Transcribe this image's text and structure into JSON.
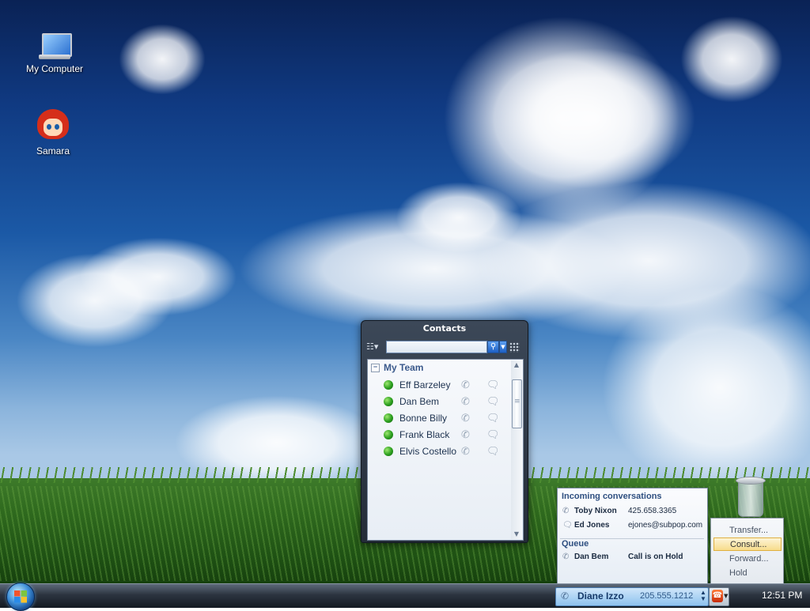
{
  "desktop": {
    "icons": [
      {
        "label": "My Computer",
        "icon": "computer-icon"
      },
      {
        "label": "Samara",
        "icon": "avatar-icon"
      }
    ],
    "recycle_bin_icon": "recycle-bin-icon"
  },
  "contacts_window": {
    "title": "Contacts",
    "search": {
      "placeholder": "",
      "value": ""
    },
    "group": {
      "label": "My Team",
      "expanded": true
    },
    "contacts": [
      {
        "name": "Eff Barzeley",
        "status": "online"
      },
      {
        "name": "Dan Bem",
        "status": "online"
      },
      {
        "name": "Bonne Billy",
        "status": "online"
      },
      {
        "name": "Frank Black",
        "status": "online"
      },
      {
        "name": "Elvis Costello",
        "status": "online"
      }
    ]
  },
  "conversations": {
    "incoming_header": "Incoming conversations",
    "incoming": [
      {
        "name": "Toby Nixon",
        "value": "425.658.3365",
        "icon": "phone-icon"
      },
      {
        "name": "Ed Jones",
        "value": "ejones@subpop.com",
        "icon": "chat-icon"
      }
    ],
    "queue_header": "Queue",
    "queue": [
      {
        "name": "Dan Bem",
        "value": "Call is on Hold",
        "icon": "phone-icon"
      }
    ]
  },
  "call_menu": {
    "items": [
      {
        "label": "Transfer...",
        "highlighted": false
      },
      {
        "label": "Consult...",
        "highlighted": true
      },
      {
        "label": "Forward...",
        "highlighted": false
      },
      {
        "label": "Hold",
        "highlighted": false
      }
    ]
  },
  "taskbar": {
    "active_call": {
      "name": "Diane Izzo",
      "number": "205.555.1212"
    },
    "clock": "12:51 PM"
  },
  "colors": {
    "online": "#2a9e1e",
    "accent": "#2e4f80",
    "menu_highlight": "#f7dc8c"
  }
}
